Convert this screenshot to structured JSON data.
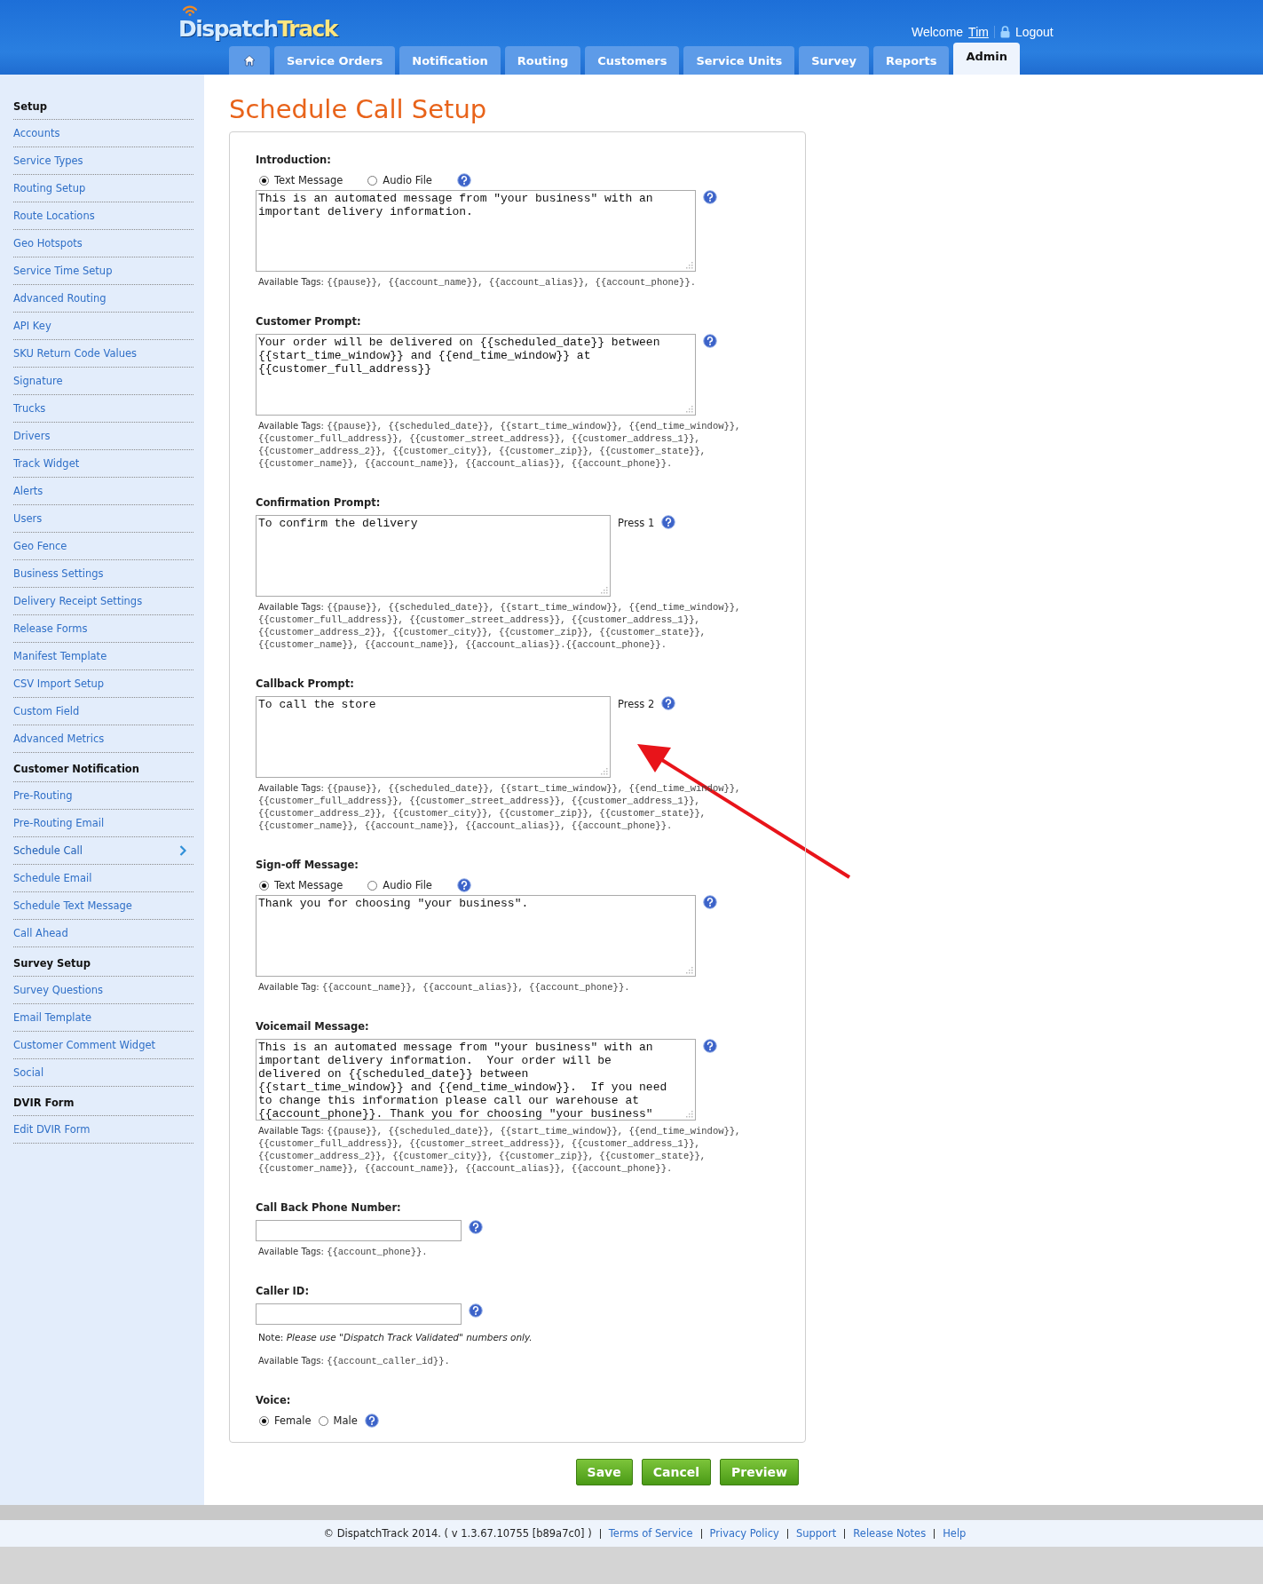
{
  "header": {
    "logo": [
      "Dispatch",
      "Track"
    ],
    "welcome": "Welcome",
    "user": "Tim",
    "logout": "Logout",
    "tabs": [
      {
        "kind": "home",
        "selected": false
      },
      {
        "kind": "text",
        "label": "Service Orders",
        "selected": false
      },
      {
        "kind": "text",
        "label": "Notification",
        "selected": false
      },
      {
        "kind": "text",
        "label": "Routing",
        "selected": false
      },
      {
        "kind": "text",
        "label": "Customers",
        "selected": false
      },
      {
        "kind": "text",
        "label": "Service Units",
        "selected": false
      },
      {
        "kind": "text",
        "label": "Survey",
        "selected": false
      },
      {
        "kind": "text",
        "label": "Reports",
        "selected": false
      },
      {
        "kind": "text",
        "label": "Admin",
        "selected": true
      }
    ]
  },
  "sidebar": {
    "groups": [
      {
        "title": "Setup",
        "items": [
          {
            "label": "Accounts",
            "selected": false
          },
          {
            "label": "Service Types",
            "selected": false
          },
          {
            "label": "Routing Setup",
            "selected": false
          },
          {
            "label": "Route Locations",
            "selected": false
          },
          {
            "label": "Geo Hotspots",
            "selected": false
          },
          {
            "label": "Service Time Setup",
            "selected": false
          },
          {
            "label": "Advanced Routing",
            "selected": false
          },
          {
            "label": "API Key",
            "selected": false
          },
          {
            "label": "SKU Return Code Values",
            "selected": false
          },
          {
            "label": "Signature",
            "selected": false
          },
          {
            "label": "Trucks",
            "selected": false
          },
          {
            "label": "Drivers",
            "selected": false
          },
          {
            "label": "Track Widget",
            "selected": false
          },
          {
            "label": "Alerts",
            "selected": false
          },
          {
            "label": "Users",
            "selected": false
          },
          {
            "label": "Geo Fence",
            "selected": false
          },
          {
            "label": "Business Settings",
            "selected": false
          },
          {
            "label": "Delivery Receipt Settings",
            "selected": false
          },
          {
            "label": "Release Forms",
            "selected": false
          },
          {
            "label": "Manifest Template",
            "selected": false
          },
          {
            "label": "CSV Import Setup",
            "selected": false
          },
          {
            "label": "Custom Field",
            "selected": false
          },
          {
            "label": "Advanced Metrics",
            "selected": false
          }
        ]
      },
      {
        "title": "Customer Notification",
        "items": [
          {
            "label": "Pre-Routing",
            "selected": false
          },
          {
            "label": "Pre-Routing Email",
            "selected": false
          },
          {
            "label": "Schedule Call",
            "selected": true
          },
          {
            "label": "Schedule Email",
            "selected": false
          },
          {
            "label": "Schedule Text Message",
            "selected": false
          },
          {
            "label": "Call Ahead",
            "selected": false
          }
        ]
      },
      {
        "title": "Survey Setup",
        "items": [
          {
            "label": "Survey Questions",
            "selected": false
          },
          {
            "label": "Email Template",
            "selected": false
          },
          {
            "label": "Customer Comment Widget",
            "selected": false
          },
          {
            "label": "Social",
            "selected": false
          }
        ]
      },
      {
        "title": "DVIR Form",
        "items": [
          {
            "label": "Edit DVIR Form",
            "selected": false
          }
        ]
      }
    ]
  },
  "title": "Schedule Call Setup",
  "sections": [
    {
      "kind": "message",
      "label": "Introduction:",
      "radios": [
        {
          "label": "Text Message",
          "selected": true
        },
        {
          "label": "Audio File",
          "selected": false
        }
      ],
      "text": "This is an automated message from \"your business\" with an\nimportant delivery information.",
      "tags_label": "Available Tags:",
      "tags": "{{pause}}, {{account_name}}, {{account_alias}}, {{account_phone}}."
    },
    {
      "kind": "message",
      "label": "Customer Prompt:",
      "text": "Your order will be delivered on {{scheduled_date}} between\n{{start_time_window}} and {{end_time_window}} at\n{{customer_full_address}}",
      "tags_label": "Available Tags:",
      "tags": "{{pause}}, {{scheduled_date}}, {{start_time_window}}, {{end_time_window}},\n{{customer_full_address}}, {{customer_street_address}}, {{customer_address_1}},\n{{customer_address_2}}, {{customer_city}}, {{customer_zip}}, {{customer_state}},\n{{customer_name}}, {{account_name}}, {{account_alias}}, {{account_phone}}."
    },
    {
      "kind": "message",
      "label": "Confirmation Prompt:",
      "text": "To confirm the delivery",
      "press": "Press 1",
      "tags_label": "Available Tags:",
      "tags": "{{pause}}, {{scheduled_date}}, {{start_time_window}}, {{end_time_window}},\n{{customer_full_address}}, {{customer_street_address}}, {{customer_address_1}},\n{{customer_address_2}}, {{customer_city}}, {{customer_zip}}, {{customer_state}},\n{{customer_name}}, {{account_name}}, {{account_alias}}.{{account_phone}}."
    },
    {
      "kind": "message",
      "label": "Callback Prompt:",
      "text": "To call the store",
      "press": "Press 2",
      "tags_label": "Available Tags:",
      "tags": "{{pause}}, {{scheduled_date}}, {{start_time_window}}, {{end_time_window}},\n{{customer_full_address}}, {{customer_street_address}}, {{customer_address_1}},\n{{customer_address_2}}, {{customer_city}}, {{customer_zip}}, {{customer_state}},\n{{customer_name}}, {{account_name}}, {{account_alias}}, {{account_phone}}."
    },
    {
      "kind": "message",
      "label": "Sign-off Message:",
      "radios": [
        {
          "label": "Text Message",
          "selected": true
        },
        {
          "label": "Audio File",
          "selected": false
        }
      ],
      "text": "Thank you for choosing \"your business\".",
      "tags_label": "Available Tag:",
      "tags": "{{account_name}}, {{account_alias}}, {{account_phone}}."
    },
    {
      "kind": "message",
      "label": "Voicemail Message:",
      "text": "This is an automated message from \"your business\" with an\nimportant delivery information.  Your order will be\ndelivered on {{scheduled_date}} between\n{{start_time_window}} and {{end_time_window}}.  If you need\nto change this information please call our warehouse at\n{{account_phone}}. Thank you for choosing \"your business\"",
      "tags_label": "Available Tags:",
      "tags": "{{pause}}, {{scheduled_date}}, {{start_time_window}}, {{end_time_window}},\n{{customer_full_address}}, {{customer_street_address}}, {{customer_address_1}},\n{{customer_address_2}}, {{customer_city}}, {{customer_zip}}, {{customer_state}},\n{{customer_name}}, {{account_name}}, {{account_alias}}, {{account_phone}}."
    },
    {
      "kind": "input",
      "label": "Call Back Phone Number:",
      "tags_label": "Available Tags:",
      "tags": "{{account_phone}}."
    },
    {
      "kind": "input",
      "label": "Caller ID:",
      "note": "Note: *Please use \"Dispatch Track Validated\" numbers only.*",
      "tags_label": "Available Tags:",
      "tags": "{{account_caller_id}}."
    },
    {
      "kind": "choice",
      "label": "Voice:",
      "options": [
        {
          "label": "Female",
          "selected": true
        },
        {
          "label": "Male",
          "selected": false
        }
      ]
    }
  ],
  "buttons": [
    "Save",
    "Cancel",
    "Preview"
  ],
  "footer": {
    "copyright": "© DispatchTrack 2014. ( v 1.3.67.10755 [b89a7c0] )",
    "links": [
      "Terms of Service",
      "Privacy Policy",
      "Support",
      "Release Notes",
      "Help"
    ]
  }
}
